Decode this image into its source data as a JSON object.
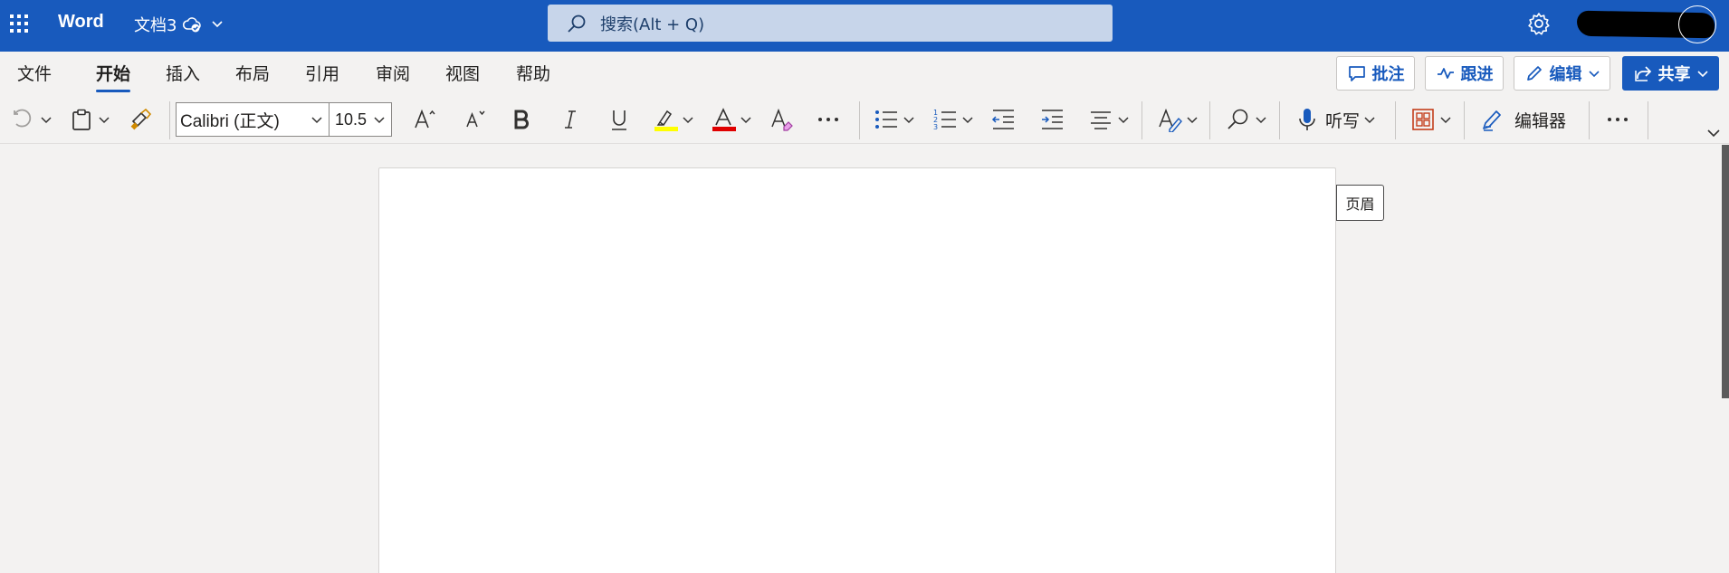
{
  "titlebar": {
    "app_name": "Word",
    "doc_name": "文档3",
    "search_placeholder": "搜索(Alt + Q)"
  },
  "menu": {
    "tabs": [
      {
        "label": "文件"
      },
      {
        "label": "开始"
      },
      {
        "label": "插入"
      },
      {
        "label": "布局"
      },
      {
        "label": "引用"
      },
      {
        "label": "审阅"
      },
      {
        "label": "视图"
      },
      {
        "label": "帮助"
      }
    ],
    "active_tab": "开始",
    "comments_label": "批注",
    "track_label": "跟进",
    "edit_label": "编辑",
    "share_label": "共享"
  },
  "toolbar": {
    "font_name": "Calibri (正文)",
    "font_size": "10.5",
    "dictate_label": "听写",
    "editor_label": "编辑器",
    "highlight_color": "#ffff00",
    "font_color": "#e00000"
  },
  "document": {
    "header_label": "页眉"
  },
  "colors": {
    "brand": "#185abd",
    "search_bg": "#c7d5ea"
  }
}
